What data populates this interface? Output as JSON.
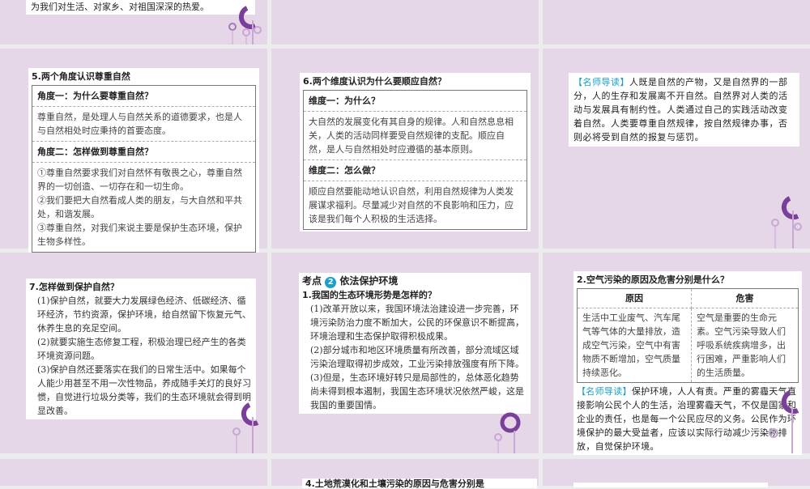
{
  "slide1": {
    "text": "为我们对生活、对家乡、对祖国深深的热爱。"
  },
  "slide5": {
    "title": "5.两个角度认识尊重自然",
    "h1": "角度一：为什么要尊重自然？",
    "b1": "尊重自然，是处理人与自然关系的道德要求，也是人与自然相处时应秉持的首要态度。",
    "h2": "角度二：怎样做到尊重自然？",
    "b2": [
      "①尊重自然要求我们对自然怀有敬畏之心，尊重自然界的一切创造、一切存在和一切生命。",
      "②我们要把大自然看成人类的朋友，与大自然和平共处，和谐发展。",
      "③尊重自然，对我们来说主要是保护生态环境，保护生物多样性。"
    ]
  },
  "slide6": {
    "title": "6.两个维度认识为什么要顺应自然？",
    "h1": "维度一：为什么？",
    "b1": "大自然的发展变化有其自身的规律。人和自然息息相关，人类的活动同样要受自然规律的支配。顺应自然，是人与自然相处时应遵循的基本原则。",
    "h2": "维度二：怎么做？",
    "b2": "顺应自然要能动地认识自然，利用自然规律为人类发展谋求福利。尽量减少对自然的不良影响和压力，应该是我们每个人积极的生活选择。"
  },
  "guide1": {
    "label": "【名师导读】",
    "text": "人既是自然的产物，又是自然界的一部分，人的生存和发展离不开自然。自然界对人类的活动与发展具有制约性。人类通过自己的实践活动改变着自然。人类要尊重自然规律，按自然规律办事，否则必将受到自然的报复与惩罚。"
  },
  "slide7": {
    "title": "7.怎样做到保护自然？",
    "items": [
      "(1)保护自然，就要大力发展绿色经济、低碳经济、循环经济，节约资源，保护环境，给自然留下恢复元气、休养生息的充足空间。",
      "(2)就要实施生态修复工程，积极治理已经产生的各类环境资源问题。",
      "(3)保护自然还要落实在我们的日常生活中。如果每个人能少用甚至不用一次性物品，养成随手关灯的良好习惯，自觉进行垃圾分类等，我们的生态环境就会得到明显改善。"
    ]
  },
  "kaodian": {
    "prefix": "考点",
    "num": "2",
    "title": "依法保护环境",
    "q": "1.我国的生态环境形势是怎样的？",
    "items": [
      "(1)改革开放以来，我国环境法治建设进一步完善，环境污染防治力度不断加大，公民的环保意识不断提高，环境治理和生态保护取得积极成果。",
      "(2)部分城市和地区环境质量有所改善，部分流域区域污染治理取得初步成效，工业污染排放强度有所下降。",
      "(3)但是，生态环境好转只是局部性的，总体恶化趋势尚未得到根本遏制，我国生态环境状况依然严峻，这是我国的重要国情。"
    ]
  },
  "air": {
    "title": "2.空气污染的原因及危害分别是什么？",
    "col1": "原因",
    "col2": "危害",
    "cause": "生活中工业废气、汽车尾气等气体的大量排放，造成空气污染，空气中有害物质不断增加，空气质量持续恶化。",
    "harm": "空气是重要的生命元素。空气污染导致人们呼吸系统疾病增多，出行困难，严重影响人们的生活质量。"
  },
  "guide2": {
    "label": "【名师导读】",
    "text": "保护环境，人人有责。严重的雾霾天气直接影响公民个人的生活，治理雾霾天气，不仅是国家和企业的责任，也是每一个公民应尽的义务。公民作为环境保护的最大受益者，应该以实际行动减少污染物排放，自觉保护环境。"
  },
  "slide4": {
    "title": "4.土地荒漠化和土壤污染的原因与危害分别是"
  },
  "colors": {
    "accent": "#1aa0c8",
    "slide_bg": "#e5d6e8",
    "deco": "#8a5aa6"
  }
}
